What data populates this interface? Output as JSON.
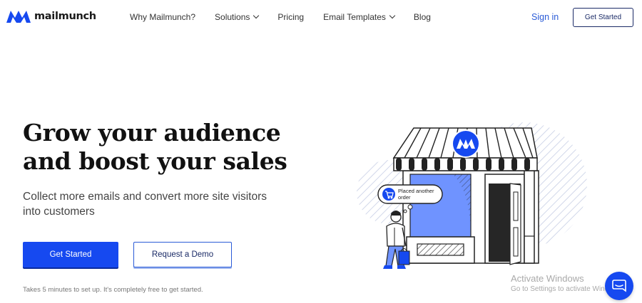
{
  "brand": {
    "name": "mailmunch",
    "accent_color": "#1649f0"
  },
  "nav": {
    "items": [
      {
        "label": "Why Mailmunch?",
        "has_dropdown": false
      },
      {
        "label": "Solutions",
        "has_dropdown": true
      },
      {
        "label": "Pricing",
        "has_dropdown": false
      },
      {
        "label": "Email Templates",
        "has_dropdown": true
      },
      {
        "label": "Blog",
        "has_dropdown": false
      }
    ],
    "sign_in": "Sign in",
    "get_started": "Get Started"
  },
  "hero": {
    "title_line1": "Grow your audience",
    "title_line2": "and boost your sales",
    "subtitle": "Collect more emails and convert more site visitors into customers",
    "primary_cta": "Get Started",
    "secondary_cta": "Request a Demo",
    "fine_print": "Takes 5 minutes to set up. It's completely free to get started."
  },
  "illustration": {
    "bubble_text_line1": "Placed another",
    "bubble_text_line2": "order"
  },
  "watermark": {
    "title": "Activate Windows",
    "subtitle": "Go to Settings to activate Windows."
  },
  "icons": {
    "chat": "chat-icon",
    "cart": "cart-icon",
    "logo": "logo-icon"
  }
}
